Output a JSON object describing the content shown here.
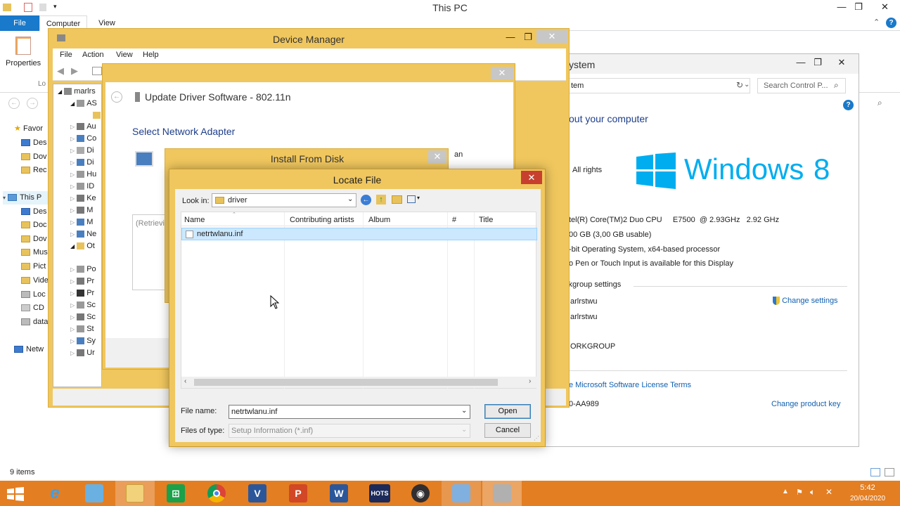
{
  "explorer": {
    "title": "This PC",
    "tabs": {
      "file": "File",
      "computer": "Computer",
      "view": "View"
    },
    "properties_label": "Properties",
    "loc_fragment": "Lo",
    "nav": {
      "favorites": "Favor",
      "items1": [
        "Des",
        "Dov",
        "Rec"
      ],
      "this_pc": "This P",
      "items2": [
        "Des",
        "Doc",
        "Dov",
        "Mus",
        "Pict",
        "Vide",
        "Loc",
        "CD",
        "data"
      ],
      "network": "Netw"
    },
    "status": "9 items"
  },
  "device_manager": {
    "title": "Device Manager",
    "menu": [
      "File",
      "Action",
      "View",
      "Help"
    ],
    "tree_root": "marlrs",
    "tree_items": [
      "AS",
      "Au",
      "Co",
      "Di",
      "Di",
      "Hu",
      "ID",
      "Ke",
      "M",
      "M",
      "Ne",
      "Ot",
      "Po",
      "Pr",
      "Pr",
      "Sc",
      "Sc",
      "St",
      "Sy",
      "Ur"
    ]
  },
  "update_driver": {
    "title": "Update Driver Software - 802.11n",
    "heading": "Select Network Adapter",
    "retrieving": "(Retrievi",
    "side_fragment": "an"
  },
  "install_disk": {
    "title": "Install From Disk"
  },
  "system": {
    "title": "ystem",
    "address": "tem",
    "search_placeholder": "Search Control P...",
    "about": "out your computer",
    "rights": "All rights",
    "windows_text": "Windows",
    "windows_version": "8",
    "cpu": "tel(R) Core(TM)2 Duo CPU     E7500  @ 2.93GHz   2.92 GHz",
    "ram": "00 GB (3,00 GB usable)",
    "os_type": "-bit Operating System, x64-based processor",
    "pen": "o Pen or Touch Input is available for this Display",
    "workgroup_heading": "rkgroup settings",
    "computer_name": "arlrstwu",
    "full_name": "arlrstwu",
    "workgroup": "ORKGROUP",
    "change_settings": "Change settings",
    "license": "e Microsoft Software License Terms",
    "product_id": "0-AA989",
    "change_key": "Change product key"
  },
  "locate_file": {
    "title": "Locate File",
    "look_in_label": "Look in:",
    "look_in_value": "driver",
    "columns": [
      "Name",
      "Contributing artists",
      "Album",
      "#",
      "Title"
    ],
    "files": [
      {
        "name": "netrtwlanu.inf"
      }
    ],
    "file_name_label": "File name:",
    "file_name_value": "netrtwlanu.inf",
    "files_type_label": "Files of type:",
    "files_type_value": "Setup Information (*.inf)",
    "open_label": "Open",
    "cancel_label": "Cancel"
  },
  "taskbar": {
    "time": "5:42",
    "date": "20/04/2020",
    "hots_label": "HOTS"
  },
  "colors": {
    "accent_blue": "#1979ca",
    "dialog_frame": "#f0c75e",
    "selection": "#cce8ff",
    "taskbar": "#e37e22",
    "link_blue": "#1160b0"
  }
}
